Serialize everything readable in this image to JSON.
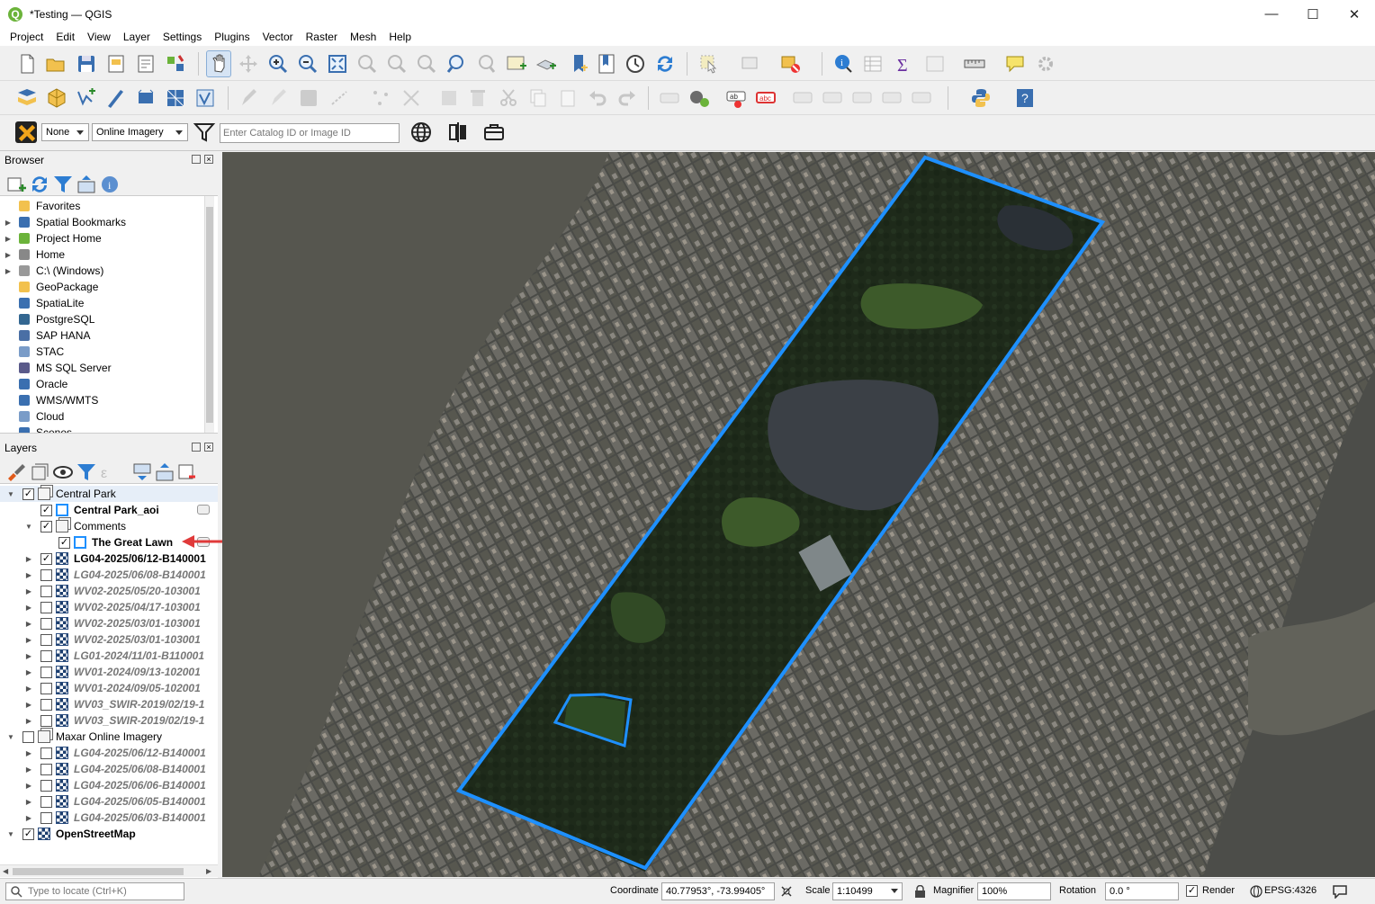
{
  "window": {
    "title": "*Testing — QGIS",
    "minimize": "—",
    "maximize": "☐",
    "close": "✕"
  },
  "menu": [
    "Project",
    "Edit",
    "View",
    "Layer",
    "Settings",
    "Plugins",
    "Vector",
    "Raster",
    "Mesh",
    "Help"
  ],
  "maxar_toolbar": {
    "filter_value": "None",
    "imagery_value": "Online Imagery",
    "catalog_placeholder": "Enter Catalog ID or Image ID"
  },
  "browser": {
    "title": "Browser",
    "items": [
      {
        "label": "Favorites",
        "icon": "star-icon",
        "expandable": false
      },
      {
        "label": "Spatial Bookmarks",
        "icon": "bookmark-icon",
        "expandable": true
      },
      {
        "label": "Project Home",
        "icon": "project-home-icon",
        "expandable": true
      },
      {
        "label": "Home",
        "icon": "home-folder-icon",
        "expandable": true
      },
      {
        "label": "C:\\ (Windows)",
        "icon": "drive-icon",
        "expandable": true
      },
      {
        "label": "GeoPackage",
        "icon": "geopackage-icon",
        "expandable": false
      },
      {
        "label": "SpatiaLite",
        "icon": "spatialite-icon",
        "expandable": false
      },
      {
        "label": "PostgreSQL",
        "icon": "postgresql-icon",
        "expandable": false
      },
      {
        "label": "SAP HANA",
        "icon": "sap-hana-icon",
        "expandable": false
      },
      {
        "label": "STAC",
        "icon": "stac-icon",
        "expandable": false
      },
      {
        "label": "MS SQL Server",
        "icon": "mssql-icon",
        "expandable": false
      },
      {
        "label": "Oracle",
        "icon": "oracle-icon",
        "expandable": false
      },
      {
        "label": "WMS/WMTS",
        "icon": "wms-icon",
        "expandable": false
      },
      {
        "label": "Cloud",
        "icon": "cloud-icon",
        "expandable": false
      },
      {
        "label": "Scenes",
        "icon": "scenes-icon",
        "expandable": false
      }
    ]
  },
  "layers": {
    "title": "Layers",
    "items": [
      {
        "label": "Central Park",
        "indent": 0,
        "type": "group",
        "checked": true,
        "expanded": true,
        "bold": false,
        "italic": false
      },
      {
        "label": "Central Park_aoi",
        "indent": 1,
        "type": "vector",
        "checked": true,
        "expanded": null,
        "bold": true,
        "italic": false,
        "badge": true
      },
      {
        "label": "Comments",
        "indent": 1,
        "type": "group",
        "checked": true,
        "expanded": true,
        "bold": false,
        "italic": false
      },
      {
        "label": "The Great Lawn",
        "indent": 2,
        "type": "vector",
        "checked": true,
        "expanded": null,
        "bold": true,
        "italic": false,
        "badge": true
      },
      {
        "label": "LG04-2025/06/12-B140001",
        "indent": 1,
        "type": "raster",
        "checked": true,
        "expanded": false,
        "bold": true,
        "italic": false
      },
      {
        "label": "LG04-2025/06/08-B140001",
        "indent": 1,
        "type": "raster",
        "checked": false,
        "expanded": false,
        "bold": true,
        "italic": true
      },
      {
        "label": "WV02-2025/05/20-103001",
        "indent": 1,
        "type": "raster",
        "checked": false,
        "expanded": false,
        "bold": true,
        "italic": true
      },
      {
        "label": "WV02-2025/04/17-103001",
        "indent": 1,
        "type": "raster",
        "checked": false,
        "expanded": false,
        "bold": true,
        "italic": true
      },
      {
        "label": "WV02-2025/03/01-103001",
        "indent": 1,
        "type": "raster",
        "checked": false,
        "expanded": false,
        "bold": true,
        "italic": true
      },
      {
        "label": "WV02-2025/03/01-103001",
        "indent": 1,
        "type": "raster",
        "checked": false,
        "expanded": false,
        "bold": true,
        "italic": true
      },
      {
        "label": "LG01-2024/11/01-B110001",
        "indent": 1,
        "type": "raster",
        "checked": false,
        "expanded": false,
        "bold": true,
        "italic": true
      },
      {
        "label": "WV01-2024/09/13-102001",
        "indent": 1,
        "type": "raster",
        "checked": false,
        "expanded": false,
        "bold": true,
        "italic": true
      },
      {
        "label": "WV01-2024/09/05-102001",
        "indent": 1,
        "type": "raster",
        "checked": false,
        "expanded": false,
        "bold": true,
        "italic": true
      },
      {
        "label": "WV03_SWIR-2019/02/19-1",
        "indent": 1,
        "type": "raster",
        "checked": false,
        "expanded": false,
        "bold": true,
        "italic": true
      },
      {
        "label": "WV03_SWIR-2019/02/19-1",
        "indent": 1,
        "type": "raster",
        "checked": false,
        "expanded": false,
        "bold": true,
        "italic": true
      },
      {
        "label": "Maxar Online Imagery",
        "indent": 0,
        "type": "group",
        "checked": false,
        "expanded": true,
        "bold": false,
        "italic": false
      },
      {
        "label": "LG04-2025/06/12-B140001",
        "indent": 1,
        "type": "raster",
        "checked": false,
        "expanded": false,
        "bold": true,
        "italic": true
      },
      {
        "label": "LG04-2025/06/08-B140001",
        "indent": 1,
        "type": "raster",
        "checked": false,
        "expanded": false,
        "bold": true,
        "italic": true
      },
      {
        "label": "LG04-2025/06/06-B140001",
        "indent": 1,
        "type": "raster",
        "checked": false,
        "expanded": false,
        "bold": true,
        "italic": true
      },
      {
        "label": "LG04-2025/06/05-B140001",
        "indent": 1,
        "type": "raster",
        "checked": false,
        "expanded": false,
        "bold": true,
        "italic": true
      },
      {
        "label": "LG04-2025/06/03-B140001",
        "indent": 1,
        "type": "raster",
        "checked": false,
        "expanded": false,
        "bold": true,
        "italic": true
      },
      {
        "label": "OpenStreetMap",
        "indent": 0,
        "type": "raster",
        "checked": true,
        "expanded": true,
        "bold": true,
        "italic": false
      }
    ]
  },
  "status": {
    "locate_placeholder": "Type to locate (Ctrl+K)",
    "coordinate_label": "Coordinate",
    "coordinate_value": "40.77953°, -73.99405°",
    "scale_label": "Scale",
    "scale_value": "1:10499",
    "magnifier_label": "Magnifier",
    "magnifier_value": "100%",
    "rotation_label": "Rotation",
    "rotation_value": "0.0 °",
    "render_label": "Render",
    "render_checked": true,
    "crs": "EPSG:4326"
  },
  "colors": {
    "accent": "#1e90ff",
    "annotation_arrow": "#e03a3a",
    "qgis_green": "#6bb33a"
  }
}
